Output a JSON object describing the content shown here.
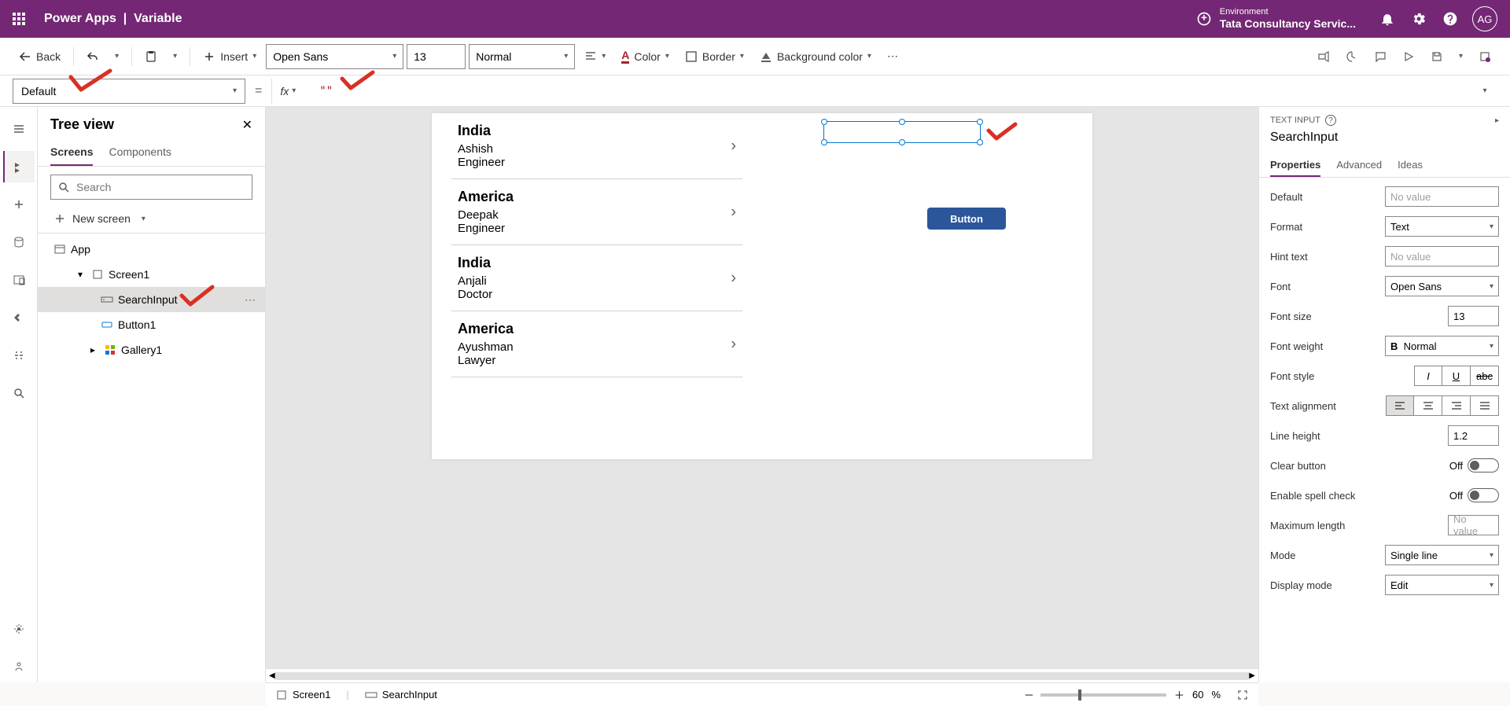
{
  "header": {
    "app": "Power Apps",
    "sep": "|",
    "page": "Variable",
    "env_label": "Environment",
    "env_name": "Tata Consultancy Servic...",
    "avatar": "AG"
  },
  "toolbar": {
    "back": "Back",
    "insert": "Insert",
    "font": "Open Sans",
    "fontsize": "13",
    "fontweight": "Normal",
    "color": "Color",
    "border": "Border",
    "bgcolor": "Background color"
  },
  "formula": {
    "property": "Default",
    "equals": "=",
    "fx": "fx",
    "value": "\"\""
  },
  "tree": {
    "title": "Tree view",
    "tabs": {
      "screens": "Screens",
      "components": "Components"
    },
    "search_placeholder": "Search",
    "new_screen": "New screen",
    "items": {
      "app": "App",
      "screen1": "Screen1",
      "searchinput": "SearchInput",
      "button1": "Button1",
      "gallery1": "Gallery1"
    }
  },
  "gallery_data": [
    {
      "title": "India",
      "sub1": "Ashish",
      "sub2": "Engineer"
    },
    {
      "title": "America",
      "sub1": "Deepak",
      "sub2": "Engineer"
    },
    {
      "title": "India",
      "sub1": "Anjali",
      "sub2": "Doctor"
    },
    {
      "title": "America",
      "sub1": "Ayushman",
      "sub2": "Lawyer"
    }
  ],
  "canvas": {
    "button_label": "Button"
  },
  "props": {
    "type": "TEXT INPUT",
    "name": "SearchInput",
    "tabs": {
      "properties": "Properties",
      "advanced": "Advanced",
      "ideas": "Ideas"
    },
    "rows": {
      "default_label": "Default",
      "default_val": "No value",
      "format_label": "Format",
      "format_val": "Text",
      "hint_label": "Hint text",
      "hint_val": "No value",
      "font_label": "Font",
      "font_val": "Open Sans",
      "fontsize_label": "Font size",
      "fontsize_val": "13",
      "fontweight_label": "Font weight",
      "fontweight_val": "Normal",
      "fontstyle_label": "Font style",
      "align_label": "Text alignment",
      "lineheight_label": "Line height",
      "lineheight_val": "1.2",
      "clear_label": "Clear button",
      "clear_val": "Off",
      "spell_label": "Enable spell check",
      "spell_val": "Off",
      "maxlen_label": "Maximum length",
      "maxlen_val": "No value",
      "mode_label": "Mode",
      "mode_val": "Single line",
      "displaymode_label": "Display mode",
      "displaymode_val": "Edit"
    }
  },
  "bottom": {
    "screen": "Screen1",
    "control": "SearchInput",
    "zoom": "60",
    "pct": "%"
  }
}
